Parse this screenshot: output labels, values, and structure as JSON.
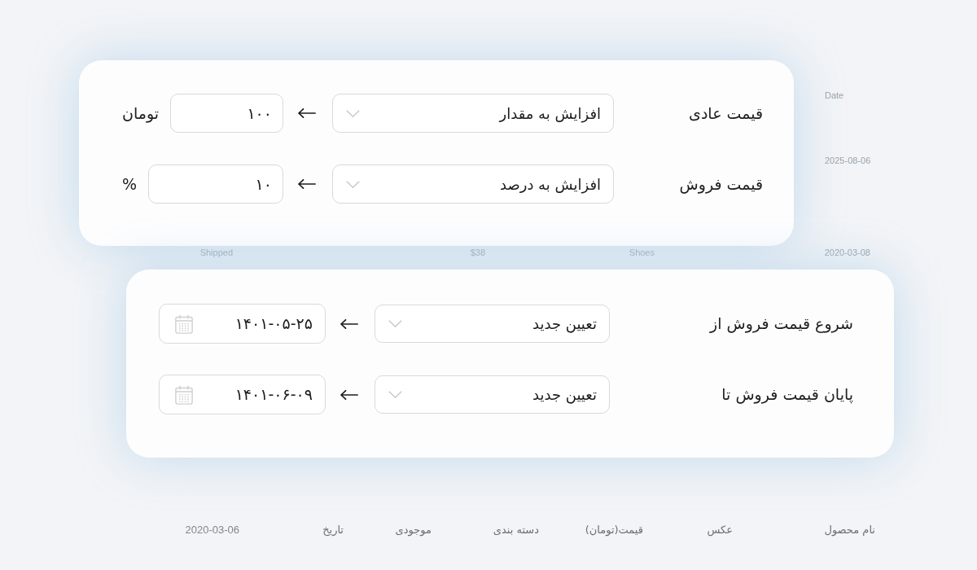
{
  "background_table": {
    "date_title": "Date",
    "date_value": "2025-08-06",
    "row": [
      "2020-03-08",
      "Shoes",
      "$38",
      "Shipped"
    ],
    "footer_headers": [
      "نام محصول",
      "عکس",
      "قیمت(تومان)",
      "دسته بندی",
      "موجودی",
      "تاریخ"
    ],
    "footer_date": "2020-03-06"
  },
  "price_panel": {
    "rows": [
      {
        "label": "قیمت عادی",
        "mode": "افزایش به مقدار",
        "value": "۱۰۰",
        "unit": "تومان"
      },
      {
        "label": "قیمت فروش",
        "mode": "افزایش به درصد",
        "value": "۱۰",
        "unit": "%"
      }
    ]
  },
  "schedule_panel": {
    "rows": [
      {
        "label": "شروع قیمت فروش از",
        "mode": "تعیین جدید",
        "date": "۱۴۰۱-۰۵-۲۵"
      },
      {
        "label": "پایان قیمت فروش تا",
        "mode": "تعیین جدید",
        "date": "۱۴۰۱-۰۶-۰۹"
      }
    ]
  }
}
